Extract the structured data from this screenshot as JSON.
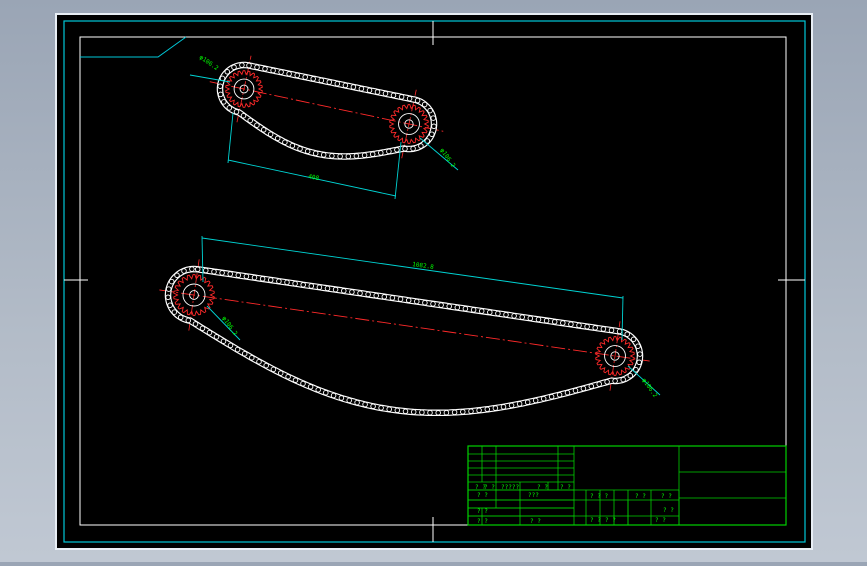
{
  "viewer": {
    "background": "#a7b1bf",
    "canvas": "#000000"
  },
  "colors": {
    "frame": "#00c8d8",
    "table": "#00d000",
    "chain": "#ffffff",
    "sprocket": "#ff2a2a",
    "centerline": "#ff2a2a",
    "dim_line": "#00d4d4",
    "dim_text": "#00ff00"
  },
  "drawing": {
    "upper_drive": {
      "sprocket_left_label": "φ106.2",
      "sprocket_right_label": "φ106.2",
      "center_distance_label": "408"
    },
    "lower_drive": {
      "sprocket_left_label": "φ106.2",
      "sprocket_right_label": "φ106.2",
      "center_distance_label": "1082.8"
    }
  },
  "title_block": {
    "cells": {
      "r5c1": "? ?",
      "r5c2": "? ?",
      "r5c3": "?????",
      "r5c4": "? ?",
      "r5c5": "? ?",
      "r6c1": "? ?",
      "r6c3": "???",
      "r7c1": "? ?",
      "r8c1": "? ?",
      "r8c3": "? ?",
      "m1": "? ? ?",
      "m2": "? ?",
      "m3": "? ?",
      "m4": "? ?",
      "m5": "? ?",
      "m6": "? ?",
      "m7": "? ?"
    }
  }
}
